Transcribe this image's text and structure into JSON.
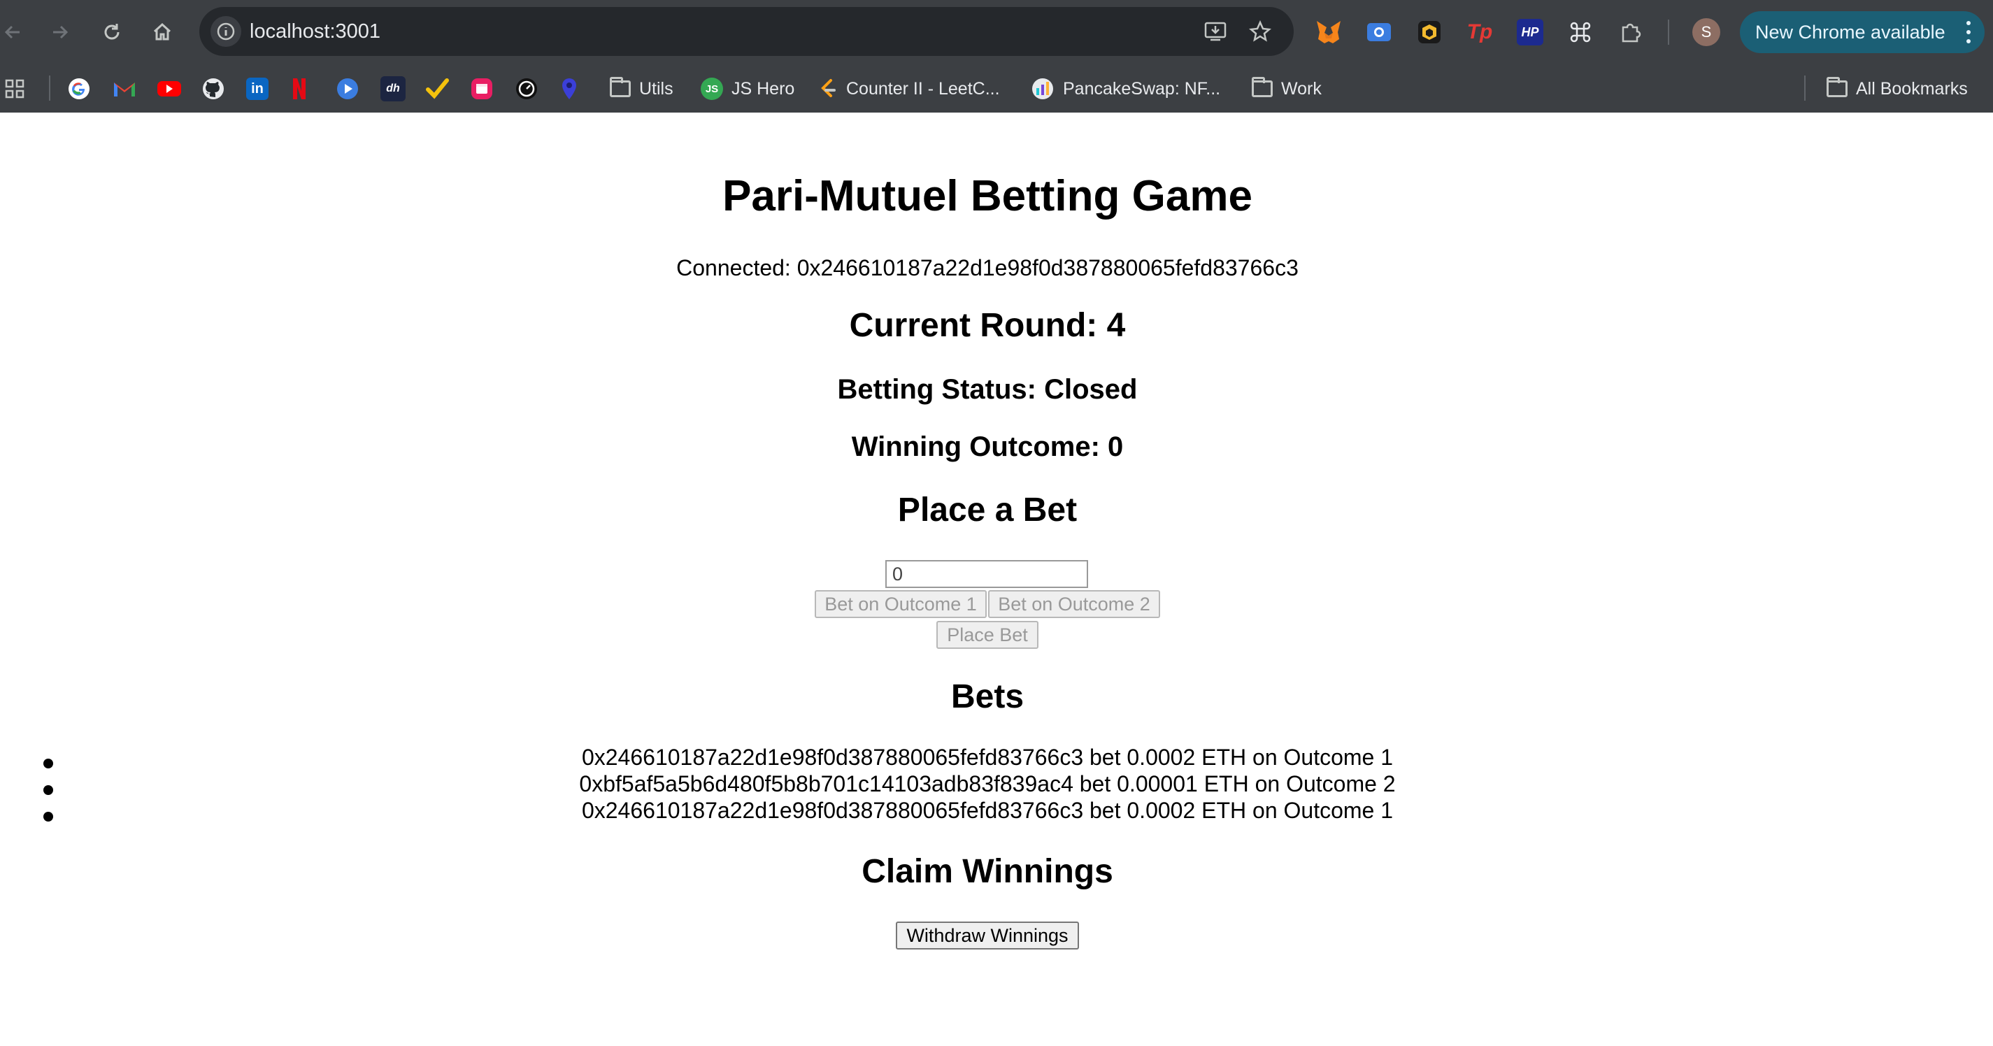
{
  "browser": {
    "url": "localhost:3001",
    "avatar_letter": "S",
    "update_label": "New Chrome available",
    "bookmarks": [
      {
        "label": "Utils"
      },
      {
        "label": "JS Hero",
        "badge": "JS"
      },
      {
        "label": "Counter II - LeetC..."
      },
      {
        "label": "PancakeSwap: NF..."
      },
      {
        "label": "Work"
      }
    ],
    "all_bookmarks": "All Bookmarks",
    "extension_labels": {
      "tp": "Tp",
      "hp": "HP"
    }
  },
  "app": {
    "title": "Pari-Mutuel Betting Game",
    "connected": "Connected: 0x246610187a22d1e98f0d387880065fefd83766c3",
    "current_round": "Current Round: 4",
    "betting_status": "Betting Status: Closed",
    "winning_outcome": "Winning Outcome: 0",
    "place_bet_heading": "Place a Bet",
    "amount_value": "0",
    "bet_outcome1_label": "Bet on Outcome 1",
    "bet_outcome2_label": "Bet on Outcome 2",
    "place_bet_label": "Place Bet",
    "bets_heading": "Bets",
    "bets": [
      "0x246610187a22d1e98f0d387880065fefd83766c3 bet 0.0002 ETH on Outcome 1",
      "0xbf5af5a5b6d480f5b8b701c14103adb83f839ac4 bet 0.00001 ETH on Outcome 2",
      "0x246610187a22d1e98f0d387880065fefd83766c3 bet 0.0002 ETH on Outcome 1"
    ],
    "claim_heading": "Claim Winnings",
    "withdraw_label": "Withdraw Winnings"
  }
}
